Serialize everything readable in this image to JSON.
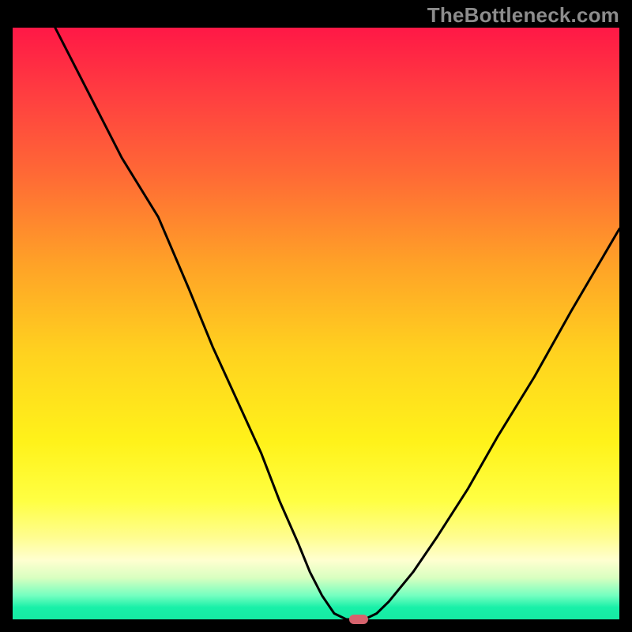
{
  "watermark": "TheBottleneck.com",
  "colors": {
    "frame_bg": "#000000",
    "gradient_top": "#ff1846",
    "gradient_mid": "#fff21a",
    "gradient_bottom": "#16eaa3",
    "curve": "#000000",
    "marker": "#d6636d"
  },
  "chart_data": {
    "type": "line",
    "title": "",
    "xlabel": "",
    "ylabel": "",
    "xlim": [
      0,
      100
    ],
    "ylim": [
      0,
      100
    ],
    "x": [
      7,
      12,
      18,
      24,
      29,
      33,
      37,
      41,
      44,
      47,
      49,
      51,
      53,
      55,
      58,
      60,
      62,
      66,
      70,
      75,
      80,
      86,
      92,
      100
    ],
    "y": [
      100,
      90,
      78,
      68,
      56,
      46,
      37,
      28,
      20,
      13,
      8,
      4,
      1,
      0,
      0,
      1,
      3,
      8,
      14,
      22,
      31,
      41,
      52,
      66
    ],
    "marker": {
      "x": 57,
      "y": 0
    },
    "annotations": []
  }
}
